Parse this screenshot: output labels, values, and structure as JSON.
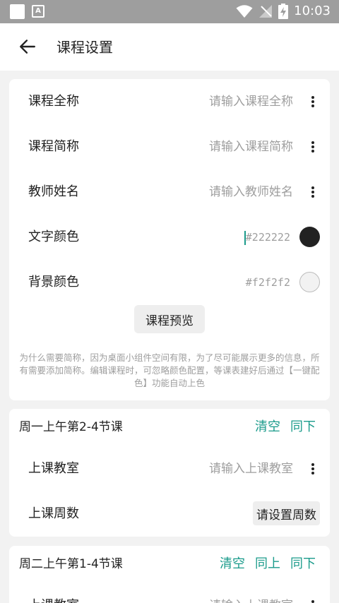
{
  "status_bar": {
    "time": "10:03",
    "font_icon_letter": "A"
  },
  "app_bar": {
    "title": "课程设置"
  },
  "form": {
    "full_name": {
      "label": "课程全称",
      "placeholder": "请输入课程全称"
    },
    "short_name": {
      "label": "课程简称",
      "placeholder": "请输入课程简称"
    },
    "teacher": {
      "label": "教师姓名",
      "placeholder": "请输入教师姓名"
    },
    "text_color": {
      "label": "文字颜色",
      "value": "#222222",
      "swatch": "#222222"
    },
    "bg_color": {
      "label": "背景颜色",
      "value": "#f2f2f2",
      "swatch": "#f2f2f2"
    },
    "preview_label": "课程预览",
    "note": "为什么需要简称，因为桌面小组件空间有限，为了尽可能展示更多的信息，所有需要添加简称。编辑课程时，可忽略颜色配置，等课表建好后通过【一键配色】功能自动上色"
  },
  "sessions": [
    {
      "title": "周一上午第2-4节课",
      "actions": [
        "清空",
        "同下"
      ],
      "room": {
        "label": "上课教室",
        "placeholder": "请输入上课教室"
      },
      "weeks": {
        "label": "上课周数",
        "button": "请设置周数"
      }
    },
    {
      "title": "周二上午第1-4节课",
      "actions": [
        "清空",
        "同上",
        "同下"
      ],
      "room": {
        "label": "上课教室",
        "placeholder": "请输入上课教室"
      }
    }
  ],
  "colors": {
    "accent": "#1a9b8b",
    "background": "#f2f2f2",
    "card": "#ffffff",
    "hint": "#9e9e9e",
    "text": "#222222"
  }
}
